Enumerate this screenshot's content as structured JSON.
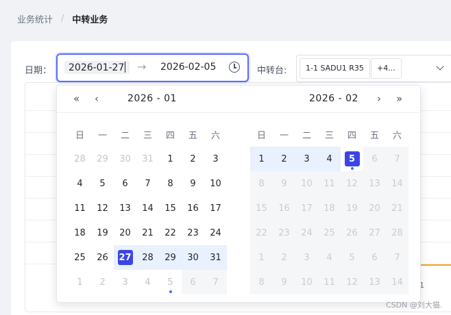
{
  "breadcrumb": {
    "parent": "业务统计",
    "separator": "/",
    "current": "中转业务"
  },
  "filters": {
    "date_label": "日期：",
    "start_date": "2026-01-27",
    "range_separator": "→",
    "end_date": "2026-02-05",
    "station_label": "中转台:",
    "station_tags": [
      "1-1 SADU1 R35",
      "+4..."
    ]
  },
  "calendar": {
    "nav": {
      "prev_year": "«",
      "prev_month": "‹",
      "next_month": "›",
      "next_year": "»"
    },
    "weekdays": [
      "日",
      "一",
      "二",
      "三",
      "四",
      "五",
      "六"
    ],
    "left": {
      "title": "2026 - 01",
      "days": [
        "28",
        "29",
        "30",
        "31",
        "1",
        "2",
        "3",
        "4",
        "5",
        "6",
        "7",
        "8",
        "9",
        "10",
        "11",
        "12",
        "13",
        "14",
        "15",
        "16",
        "17",
        "18",
        "19",
        "20",
        "21",
        "22",
        "23",
        "24",
        "25",
        "26",
        "27",
        "28",
        "29",
        "30",
        "31",
        "1",
        "2",
        "3",
        "4",
        "5",
        "6",
        "7"
      ],
      "selected": "27"
    },
    "right": {
      "title": "2026 - 02",
      "days": [
        "1",
        "2",
        "3",
        "4",
        "5",
        "6",
        "7",
        "8",
        "9",
        "10",
        "11",
        "12",
        "13",
        "14",
        "15",
        "16",
        "17",
        "18",
        "19",
        "20",
        "21",
        "22",
        "23",
        "24",
        "25",
        "26",
        "27",
        "28",
        "1",
        "2",
        "3",
        "4",
        "5",
        "6",
        "7",
        "8",
        "9",
        "10",
        "11",
        "12",
        "13",
        "14"
      ],
      "selected": "5"
    }
  },
  "chart": {
    "tick": "1"
  },
  "watermark": "CSDN @刘大猫."
}
